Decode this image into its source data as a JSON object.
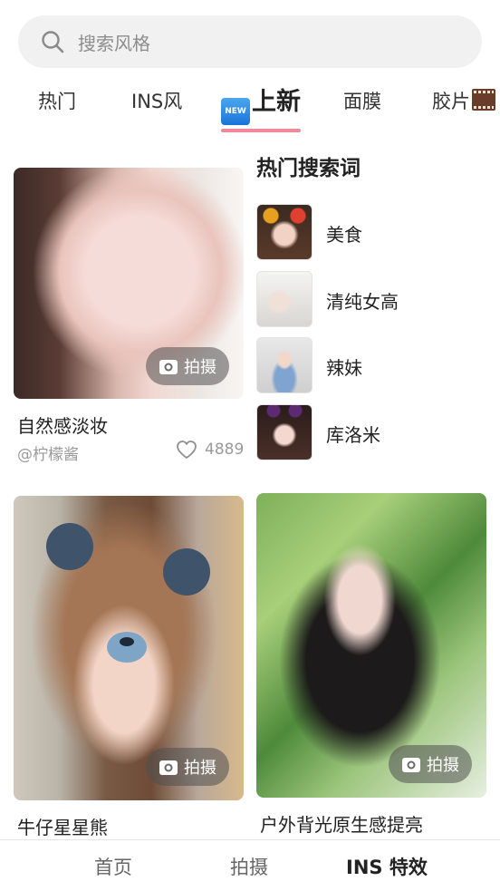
{
  "search": {
    "placeholder": "搜索风格",
    "icon": "search-icon"
  },
  "tabs": [
    {
      "label": "热门"
    },
    {
      "label": "INS风"
    },
    {
      "label": "上新",
      "badge": "NEW",
      "active": true
    },
    {
      "label": "面膜"
    },
    {
      "label": "胶片",
      "icon": "film-icon"
    }
  ],
  "accent_color": "#f08a9a",
  "feed": [
    {
      "title": "自然感淡妆",
      "author": "@柠檬酱",
      "likes": "4889",
      "action": "拍摄"
    },
    {
      "title": "牛仔星星熊",
      "action": "拍摄"
    },
    {
      "title": "户外背光原生感提亮",
      "action": "拍摄"
    }
  ],
  "hot_search": {
    "title": "热门搜索词",
    "items": [
      {
        "label": "美食"
      },
      {
        "label": "清纯女高"
      },
      {
        "label": "辣妹"
      },
      {
        "label": "库洛米"
      }
    ]
  },
  "bottom_nav": [
    {
      "label": "首页"
    },
    {
      "label": "拍摄"
    },
    {
      "label": "INS 特效",
      "active": true
    }
  ]
}
